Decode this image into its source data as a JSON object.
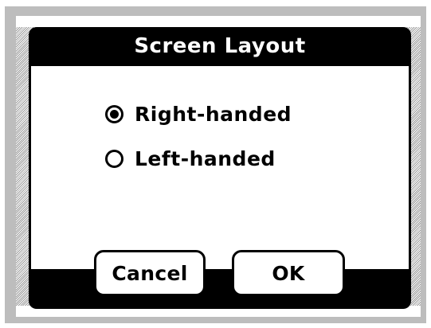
{
  "dialog": {
    "title": "Screen Layout",
    "options": [
      {
        "label": "Right-handed",
        "selected": true
      },
      {
        "label": "Left-handed",
        "selected": false
      }
    ],
    "buttons": {
      "cancel": "Cancel",
      "ok": "OK"
    }
  },
  "colors": {
    "dialog_frame": "#000000",
    "dialog_body": "#ffffff",
    "outer_frame": "#bdbdbd"
  }
}
